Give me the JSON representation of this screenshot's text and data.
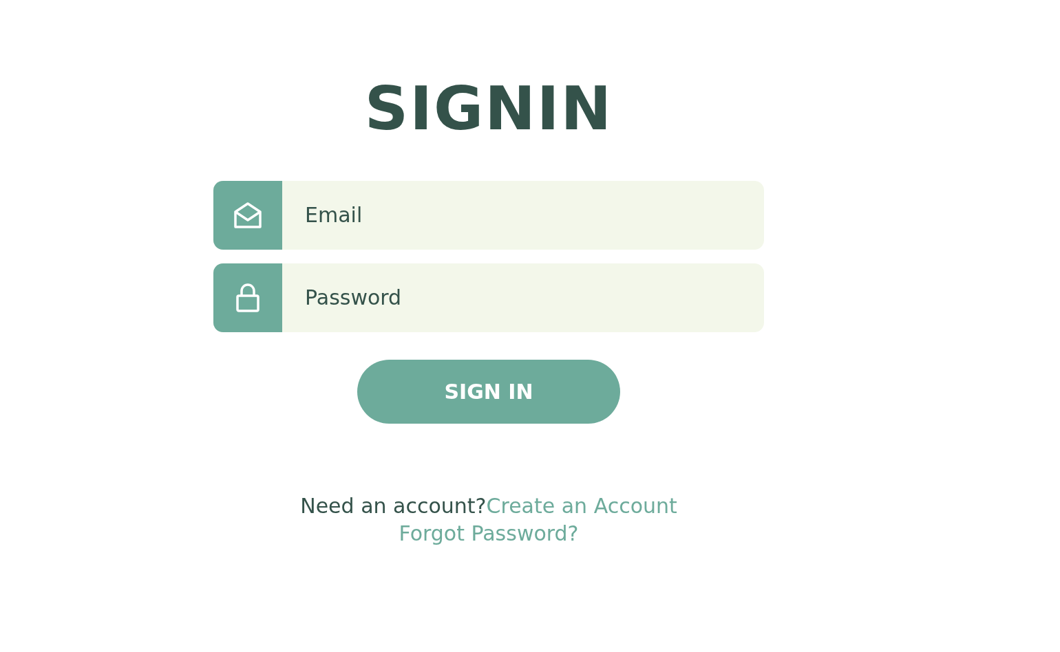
{
  "title": "SIGNIN",
  "fields": [
    {
      "kind": "email",
      "placeholder": "Email"
    },
    {
      "kind": "password",
      "placeholder": "Password"
    }
  ],
  "button": "SIGN IN",
  "footer": {
    "prompt": "Need an account?",
    "create_link": "Create an Account",
    "forgot_link": "Forgot Password?"
  }
}
